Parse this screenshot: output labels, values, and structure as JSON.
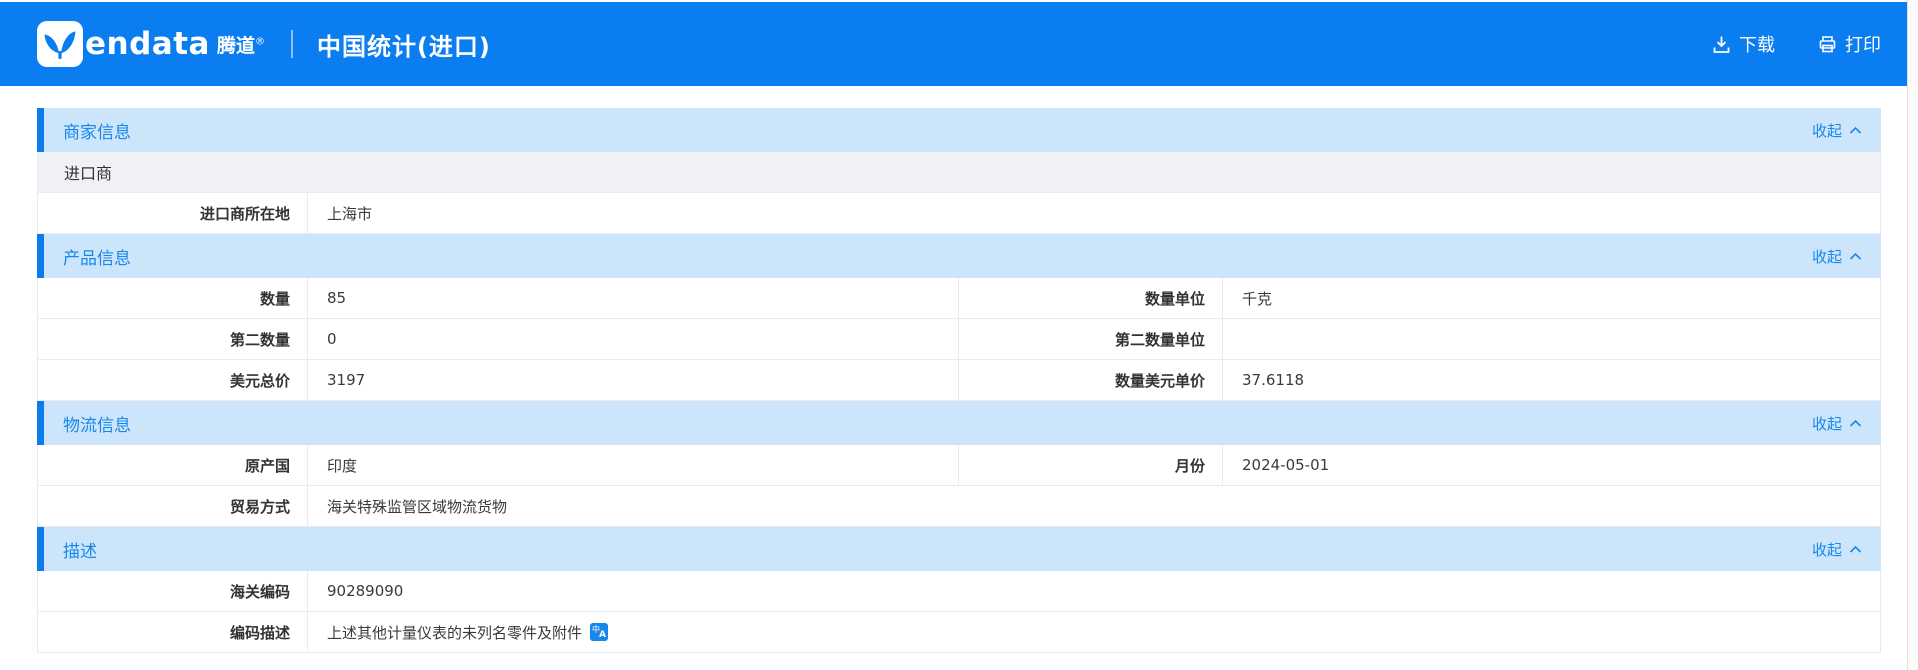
{
  "colors": {
    "header_blue": "#0a7df0",
    "section_band_blue": "#cde5fa",
    "accent_blue": "#0d7ceb",
    "link_blue": "#1787ec",
    "banner_gray": "#f0f1f5"
  },
  "header": {
    "brand": {
      "wordmark": "endata",
      "cjk": "腾道",
      "reg": "®"
    },
    "title": "中国统计(进口)",
    "actions": {
      "download": "下载",
      "print": "打印"
    },
    "icons": {
      "logo": "tendata-logo-icon",
      "download": "download-icon",
      "print": "printer-icon"
    }
  },
  "sections": [
    {
      "title": "商家信息",
      "collapse_label": "收起",
      "rows": [
        {
          "kind": "banner",
          "text": "进口商"
        },
        {
          "kind": "single",
          "label": "进口商所在地",
          "value": "上海市"
        }
      ]
    },
    {
      "title": "产品信息",
      "collapse_label": "收起",
      "rows": [
        {
          "kind": "double",
          "label1": "数量",
          "value1": "85",
          "label2": "数量单位",
          "value2": "千克"
        },
        {
          "kind": "double",
          "label1": "第二数量",
          "value1": "0",
          "label2": "第二数量单位",
          "value2": ""
        },
        {
          "kind": "double",
          "label1": "美元总价",
          "value1": "3197",
          "label2": "数量美元单价",
          "value2": "37.6118"
        }
      ]
    },
    {
      "title": "物流信息",
      "collapse_label": "收起",
      "rows": [
        {
          "kind": "double",
          "label1": "原产国",
          "value1": "印度",
          "label2": "月份",
          "value2": "2024-05-01"
        },
        {
          "kind": "single",
          "label": "贸易方式",
          "value": "海关特殊监管区域物流货物"
        }
      ]
    },
    {
      "title": "描述",
      "collapse_label": "收起",
      "rows": [
        {
          "kind": "single",
          "label": "海关编码",
          "value": "90289090"
        },
        {
          "kind": "single",
          "label": "编码描述",
          "value": "上述其他计量仪表的未列名零件及附件",
          "icon": "translate-icon",
          "icon_zh": "中",
          "icon_en": "A"
        }
      ]
    }
  ]
}
